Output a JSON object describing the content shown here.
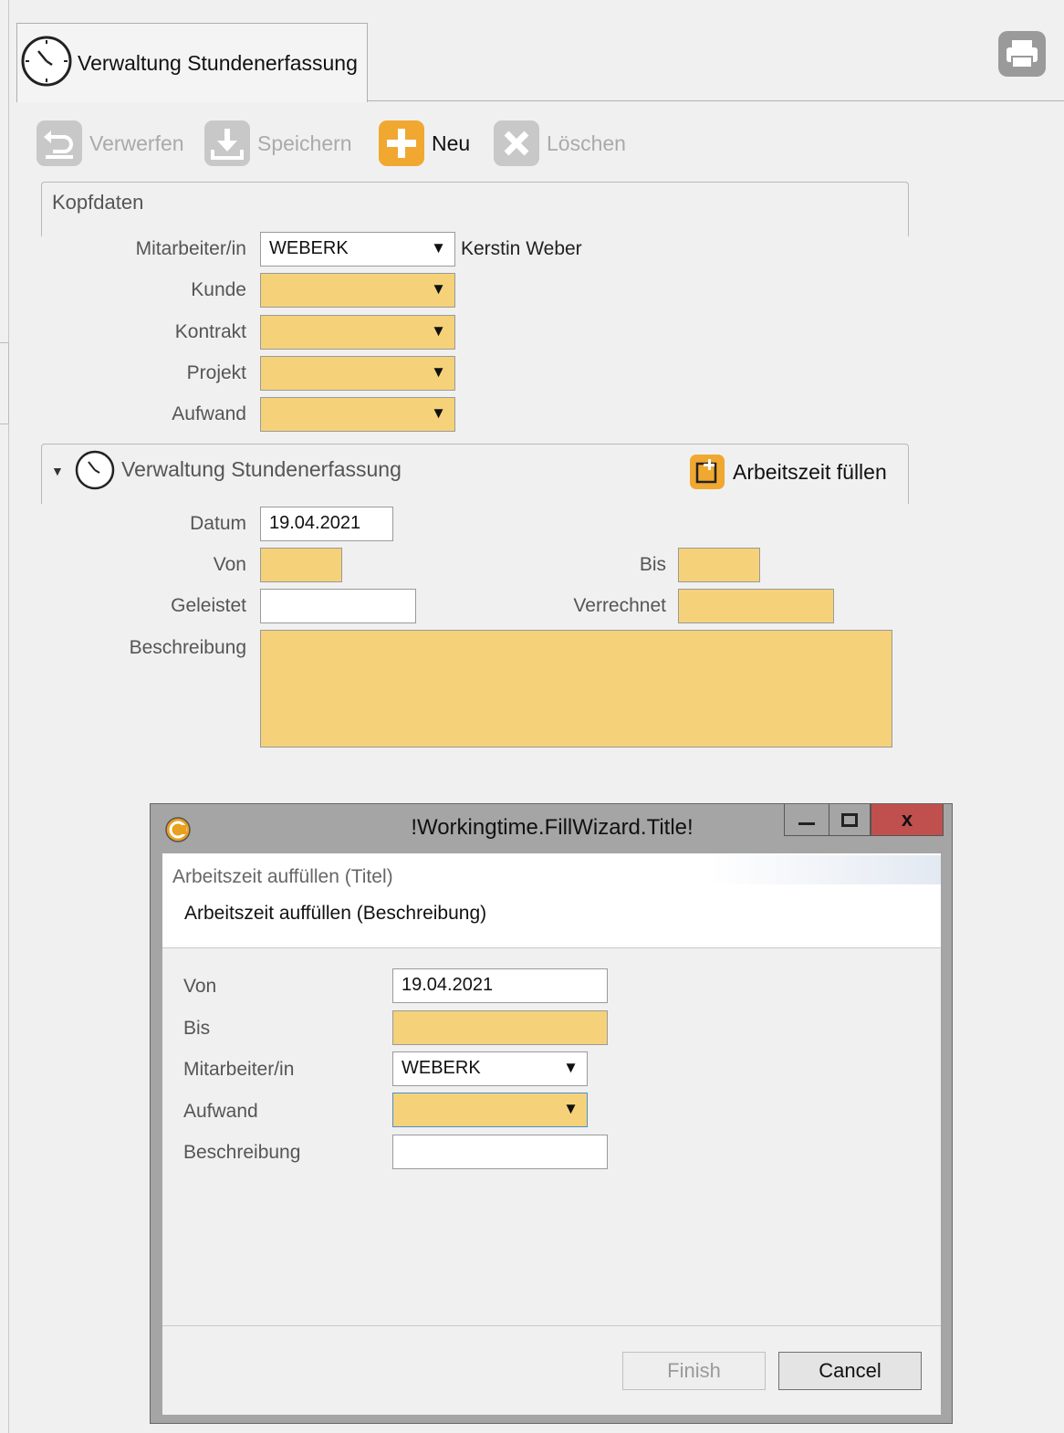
{
  "tab": {
    "title": "Verwaltung Stundenerfassung"
  },
  "toolbar": {
    "discard": "Verwerfen",
    "save": "Speichern",
    "new": "Neu",
    "delete": "Löschen"
  },
  "kopfdaten": {
    "title": "Kopfdaten",
    "employee_label": "Mitarbeiter/in",
    "employee_value": "WEBERK",
    "employee_name": "Kerstin Weber",
    "customer_label": "Kunde",
    "contract_label": "Kontrakt",
    "project_label": "Projekt",
    "effort_label": "Aufwand"
  },
  "section": {
    "title": "Verwaltung Stundenerfassung",
    "fill_button": "Arbeitszeit füllen",
    "date_label": "Datum",
    "date_value": "19.04.2021",
    "from_label": "Von",
    "to_label": "Bis",
    "done_label": "Geleistet",
    "billed_label": "Verrechnet",
    "desc_label": "Beschreibung"
  },
  "dialog": {
    "title": "!Workingtime.FillWizard.Title!",
    "header_title": "Arbeitszeit auffüllen (Titel)",
    "header_desc": "Arbeitszeit auffüllen (Beschreibung)",
    "from_label": "Von",
    "from_value": "19.04.2021",
    "to_label": "Bis",
    "employee_label": "Mitarbeiter/in",
    "employee_value": "WEBERK",
    "effort_label": "Aufwand",
    "desc_label": "Beschreibung",
    "finish": "Finish",
    "cancel": "Cancel"
  },
  "colors": {
    "required_field": "#f5d27a",
    "accent": "#f0a830"
  }
}
